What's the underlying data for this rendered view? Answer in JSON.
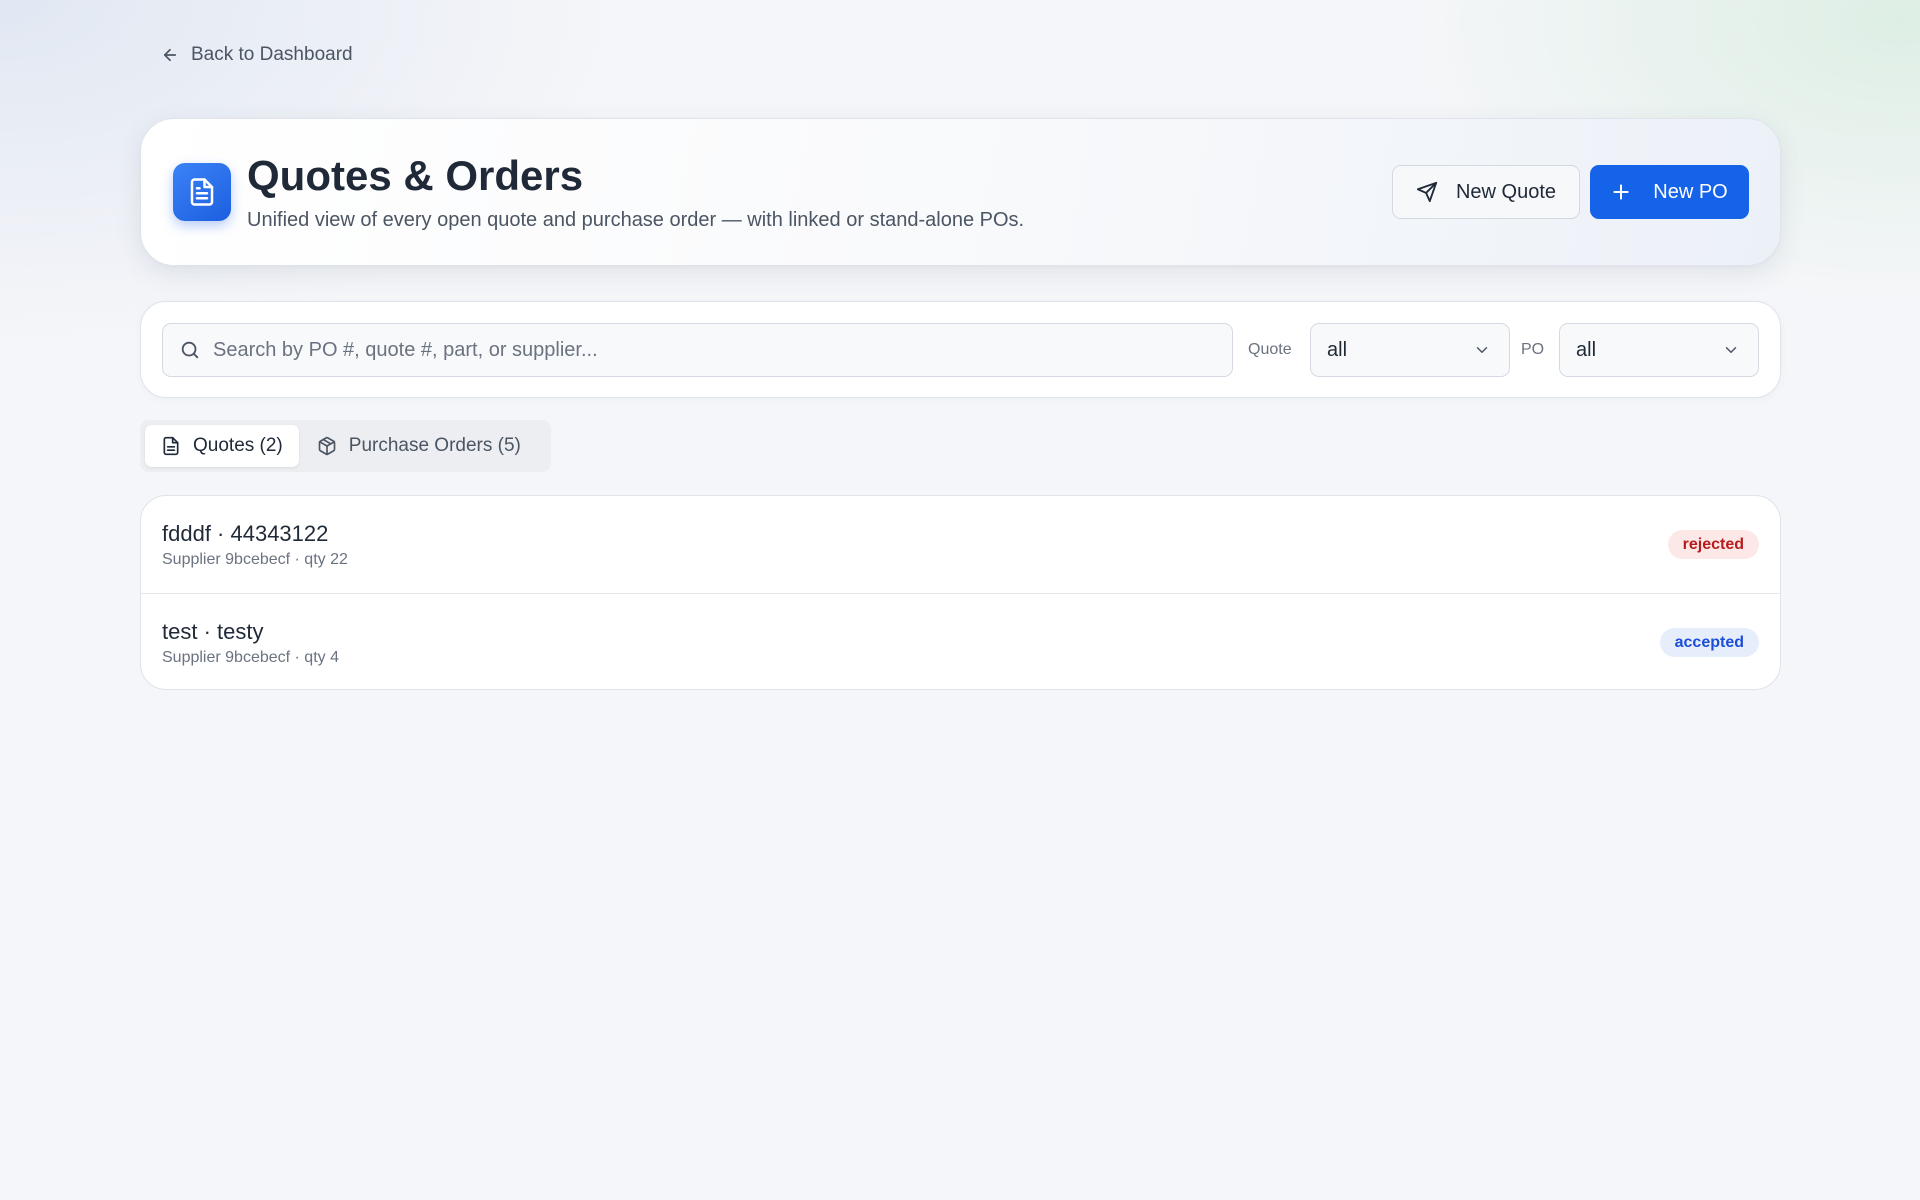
{
  "nav": {
    "back_label": "Back to Dashboard"
  },
  "header": {
    "title": "Quotes & Orders",
    "subtitle": "Unified view of every open quote and purchase order — with linked or stand-alone POs.",
    "new_quote_label": "New Quote",
    "new_po_label": "New PO"
  },
  "filters": {
    "search_placeholder": "Search by PO #, quote #, part, or supplier...",
    "search_value": "",
    "quote_label": "Quote",
    "quote_value": "all",
    "po_label": "PO",
    "po_value": "all"
  },
  "tabs": [
    {
      "label": "Quotes (2)",
      "icon": "document-icon",
      "active": true
    },
    {
      "label": "Purchase Orders (5)",
      "icon": "package-icon",
      "active": false
    }
  ],
  "quotes": [
    {
      "title": "fdddf · 44343122",
      "subtitle": "Supplier 9bcebecf · qty 22",
      "status": "rejected"
    },
    {
      "title": "test · testy",
      "subtitle": "Supplier 9bcebecf · qty 4",
      "status": "accepted"
    }
  ],
  "colors": {
    "primary": "#1463e8",
    "rejected_bg": "#fde8e8",
    "rejected_text": "#b91c1c",
    "accepted_bg": "#e6eefc",
    "accepted_text": "#1d4ed8"
  }
}
